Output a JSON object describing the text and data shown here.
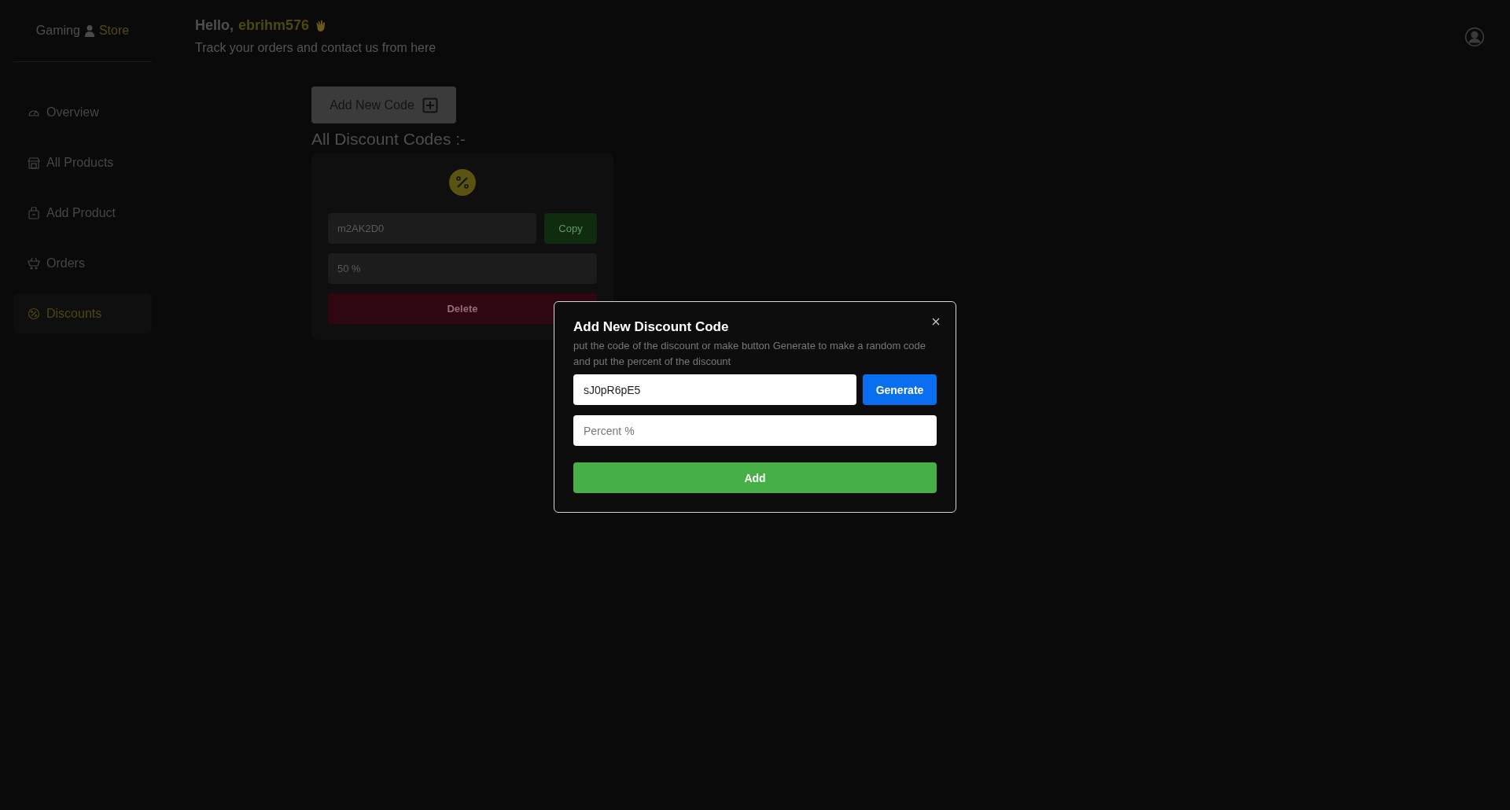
{
  "brand": {
    "first": "Gaming",
    "second": "Store"
  },
  "header": {
    "greeting": "Hello,",
    "username": "ebrihm576",
    "subtitle": "Track your orders and contact us from here"
  },
  "sidebar": {
    "items": [
      {
        "label": "Overview",
        "kind": "gauge",
        "selected": false
      },
      {
        "label": "All Products",
        "kind": "store",
        "selected": false
      },
      {
        "label": "Add Product",
        "kind": "bag",
        "selected": false
      },
      {
        "label": "Orders",
        "kind": "cart",
        "selected": false
      },
      {
        "label": "Discounts",
        "kind": "badge",
        "selected": true
      }
    ]
  },
  "add_button": {
    "label": "Add New Code"
  },
  "section_title": "All Discount Codes :-",
  "discount_cards": [
    {
      "code": "m2AK2D0",
      "percent": "50 %",
      "copy_label": "Copy",
      "delete_label": "Delete"
    }
  ],
  "modal": {
    "title": "Add New Discount Code",
    "description": "put the code of the discount or make button Generate to make a random code and put the percent of the discount",
    "code_value": "sJ0pR6pE5",
    "generate_label": "Generate",
    "percent_placeholder": "Percent %",
    "add_label": "Add"
  }
}
